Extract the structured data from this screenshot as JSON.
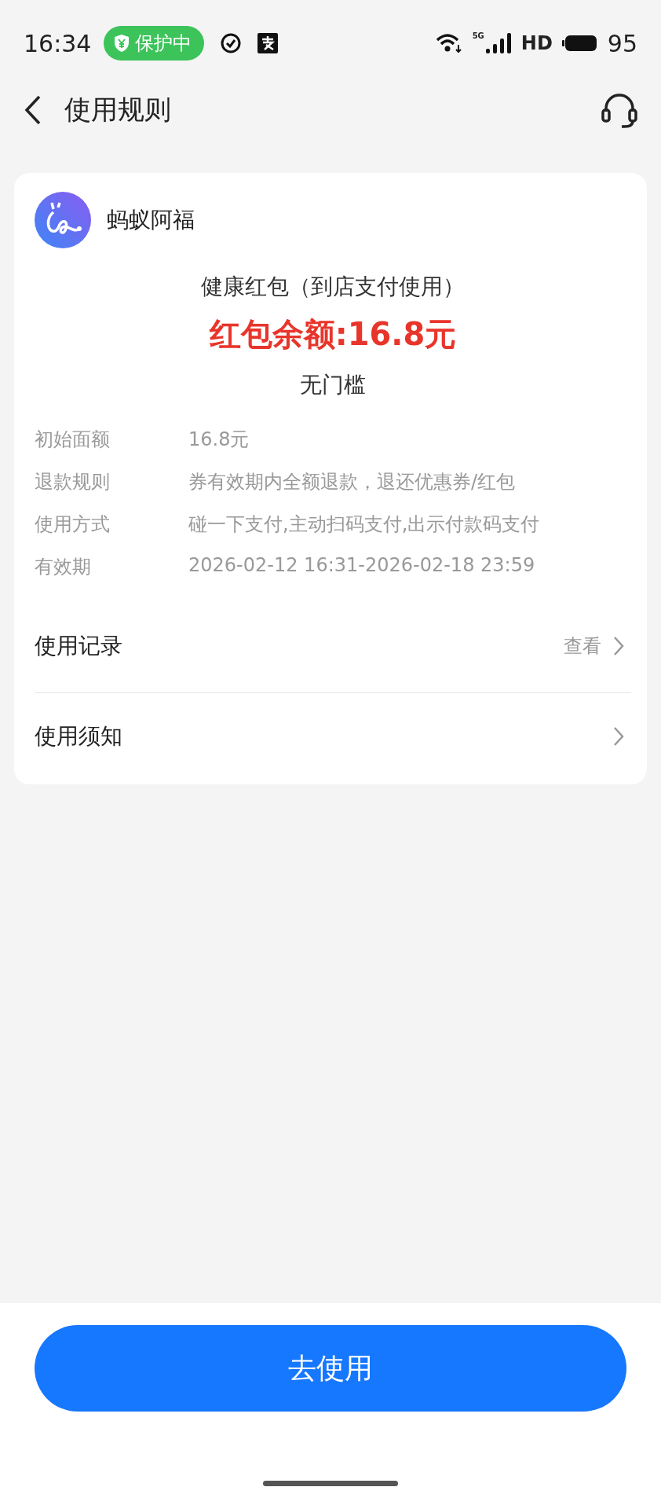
{
  "status_bar": {
    "time": "16:34",
    "protect_badge": "保护中",
    "network": "5G",
    "hd": "HD",
    "battery": "95"
  },
  "nav": {
    "title": "使用规则"
  },
  "card": {
    "brand": "蚂蚁阿福",
    "coupon_title": "健康红包（到店支付使用）",
    "balance": "红包余额:16.8元",
    "threshold": "无门槛",
    "details": [
      {
        "label": "初始面额",
        "value": "16.8元"
      },
      {
        "label": "退款规则",
        "value": "券有效期内全额退款，退还优惠券/红包"
      },
      {
        "label": "使用方式",
        "value": "碰一下支付,主动扫码支付,出示付款码支付"
      },
      {
        "label": "有效期",
        "value": "2026-02-12 16:31-2026-02-18 23:59"
      }
    ],
    "links": [
      {
        "label": "使用记录",
        "action": "查看"
      },
      {
        "label": "使用须知"
      }
    ]
  },
  "button": "去使用"
}
